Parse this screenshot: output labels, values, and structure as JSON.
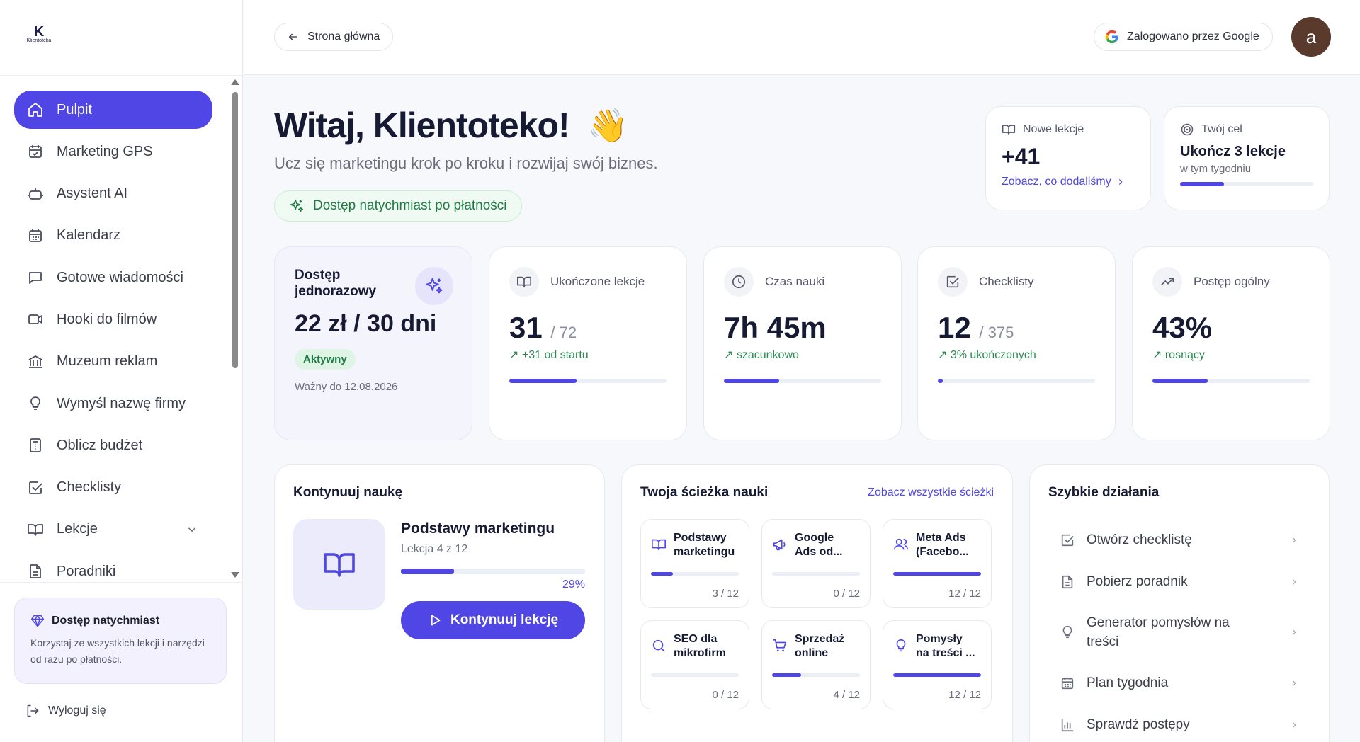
{
  "brand": {
    "logo_letter": "K",
    "logo_text": "Klientoteka",
    "accent": "#4f46e5"
  },
  "sidebar": {
    "items": [
      {
        "label": "Pulpit",
        "icon": "home-icon",
        "active": true
      },
      {
        "label": "Marketing GPS",
        "icon": "calendar-check-icon"
      },
      {
        "label": "Asystent AI",
        "icon": "robot-icon"
      },
      {
        "label": "Kalendarz",
        "icon": "calendar-icon"
      },
      {
        "label": "Gotowe wiadomości",
        "icon": "message-icon"
      },
      {
        "label": "Hooki do filmów",
        "icon": "video-icon"
      },
      {
        "label": "Muzeum reklam",
        "icon": "museum-icon"
      },
      {
        "label": "Wymyśl nazwę firmy",
        "icon": "lightbulb-icon"
      },
      {
        "label": "Oblicz budżet",
        "icon": "calculator-icon"
      },
      {
        "label": "Checklisty",
        "icon": "checkbox-icon"
      },
      {
        "label": "Lekcje",
        "icon": "book-icon"
      },
      {
        "label": "Poradniki",
        "icon": "document-icon"
      }
    ],
    "promo": {
      "title": "Dostęp natychmiast",
      "text": "Korzystaj ze wszystkich lekcji i narzędzi od razu po płatności."
    },
    "logout": "Wyloguj się"
  },
  "topbar": {
    "home": "Strona główna",
    "login": "Zalogowano przez Google",
    "avatar": "a"
  },
  "hero": {
    "greeting": "Witaj, Klientoteko!",
    "wave": "👋",
    "subtitle": "Ucz się marketingu krok po kroku i rozwijaj swój biznes.",
    "instant": "Dostęp natychmiast po płatności"
  },
  "new_lessons": {
    "label": "Nowe lekcje",
    "value": "+41",
    "link": "Zobacz, co dodaliśmy"
  },
  "goal": {
    "label": "Twój cel",
    "title": "Ukończ 3 lekcje",
    "sub": "w tym tygodniu",
    "progress": 0.33
  },
  "access": {
    "title": "Dostęp jednorazowy",
    "price": "22 zł / 30 dni",
    "badge": "Aktywny",
    "valid": "Ważny do 12.08.2026"
  },
  "stats": [
    {
      "label": "Ukończone lekcje",
      "value": "31",
      "den": "/ 72",
      "trend": "↗ +31 od startu",
      "progress": 0.43
    },
    {
      "label": "Czas nauki",
      "value": "7h 45m",
      "den": "",
      "trend": "↗ szacunkowo",
      "progress": 0.35
    },
    {
      "label": "Checklisty",
      "value": "12",
      "den": "/ 375",
      "trend": "↗ 3% ukończonych",
      "progress": 0.03
    },
    {
      "label": "Postęp ogólny",
      "value": "43%",
      "den": "",
      "trend": "↗ rosnący",
      "progress": 0.35
    }
  ],
  "continue": {
    "title": "Kontynuuj naukę",
    "course": "Podstawy marketingu",
    "lesson": "Lekcja 4 z 12",
    "pct": "29%",
    "progress": 0.29,
    "button": "Kontynuuj lekcję"
  },
  "paths": {
    "title": "Twoja ścieżka nauki",
    "link": "Zobacz wszystkie ścieżki",
    "items": [
      {
        "line1": "Podstawy",
        "line2": "marketingu",
        "count": "3 / 12",
        "progress": 0.25
      },
      {
        "line1": "Google",
        "line2": "Ads od...",
        "count": "0 / 12",
        "progress": 0
      },
      {
        "line1": "Meta Ads",
        "line2": "(Facebo...",
        "count": "12 / 12",
        "progress": 1
      },
      {
        "line1": "SEO dla",
        "line2": "mikrofirm",
        "count": "0 / 12",
        "progress": 0
      },
      {
        "line1": "Sprzedaż",
        "line2": "online",
        "count": "4 / 12",
        "progress": 0.33
      },
      {
        "line1": "Pomysły",
        "line2": "na treści ...",
        "count": "12 / 12",
        "progress": 1
      }
    ]
  },
  "quick": {
    "title": "Szybkie działania",
    "items": [
      {
        "label": "Otwórz checklistę"
      },
      {
        "label": "Pobierz poradnik"
      },
      {
        "label": "Generator pomysłów na treści"
      },
      {
        "label": "Plan tygodnia"
      },
      {
        "label": "Sprawdź postępy"
      }
    ]
  }
}
